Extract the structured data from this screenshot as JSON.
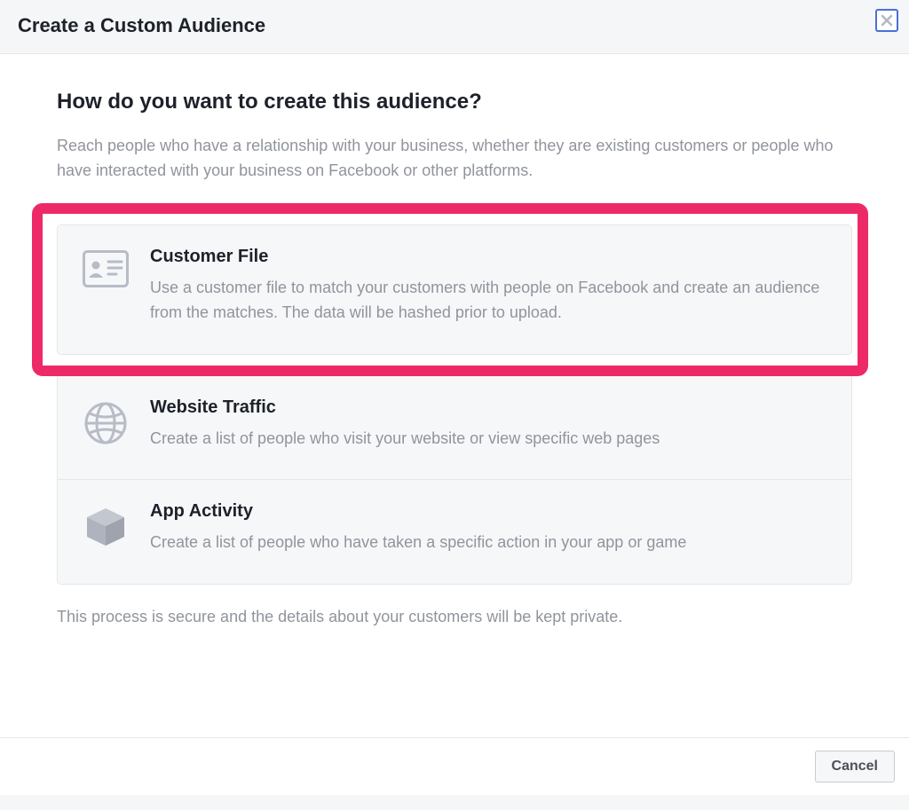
{
  "dialog": {
    "title": "Create a Custom Audience",
    "question": "How do you want to create this audience?",
    "subtitle": "Reach people who have a relationship with your business, whether they are existing customers or people who have interacted with your business on Facebook or other platforms.",
    "secure_note": "This process is secure and the details about your customers will be kept private.",
    "cancel_label": "Cancel"
  },
  "options": {
    "customer_file": {
      "title": "Customer File",
      "desc": "Use a customer file to match your customers with people on Facebook and create an audience from the matches. The data will be hashed prior to upload."
    },
    "website_traffic": {
      "title": "Website Traffic",
      "desc": "Create a list of people who visit your website or view specific web pages"
    },
    "app_activity": {
      "title": "App Activity",
      "desc": "Create a list of people who have taken a specific action in your app or game"
    }
  }
}
